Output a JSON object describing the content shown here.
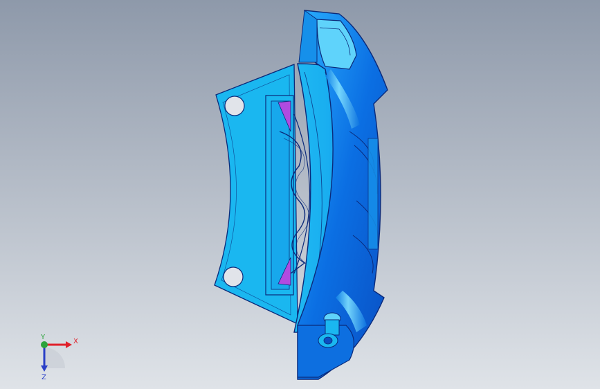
{
  "colors": {
    "background_top": "#8e99aa",
    "background_bottom": "#dfe3e8",
    "part_body": "#1ab7f0",
    "part_body_light": "#5fd3fb",
    "part_dark": "#0a62d8",
    "part_mid": "#1690ea",
    "edge": "#0b2a7a",
    "pad_accent": "#b04be0",
    "axis_x": "#e0202a",
    "axis_y": "#2ca33b",
    "axis_z": "#2a3fc7"
  },
  "triad": {
    "x_label": "X",
    "y_label": "Y",
    "z_label": "Z"
  }
}
